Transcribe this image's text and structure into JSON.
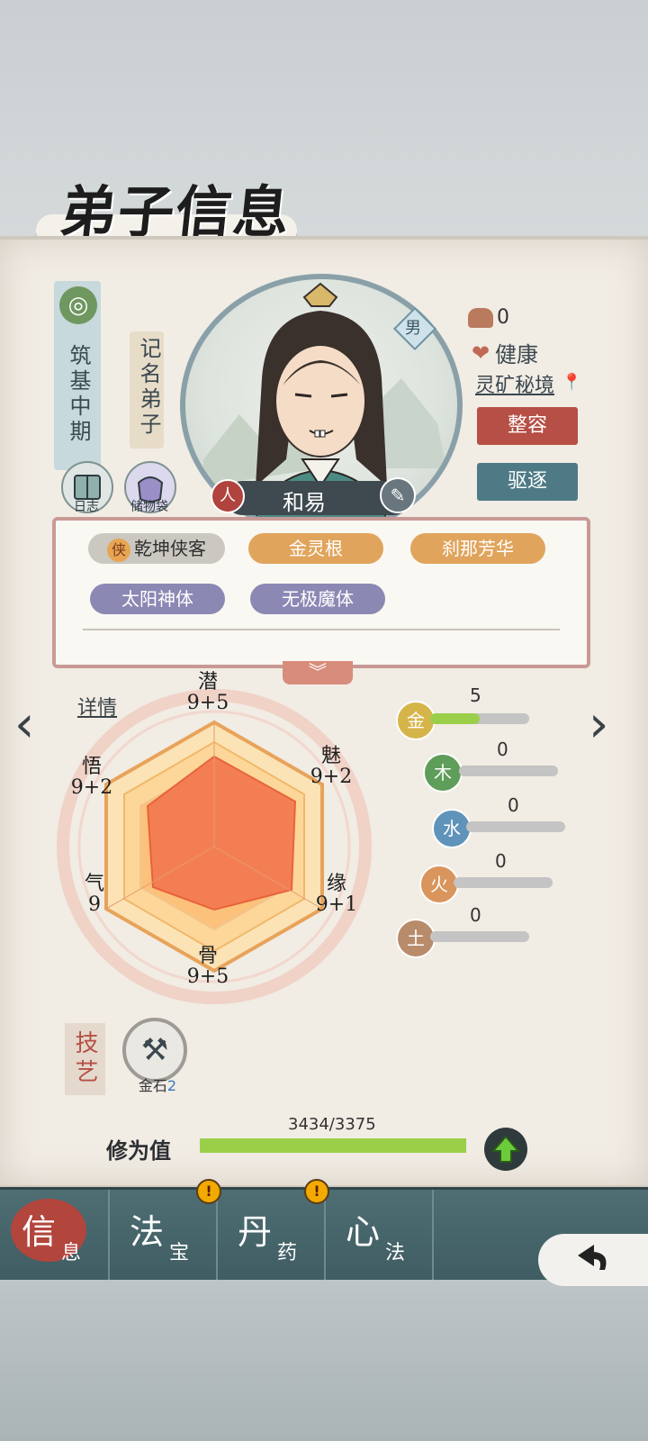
{
  "title": "弟子信息",
  "realm": {
    "text": "筑基中期",
    "icon": "spiral-emblem-icon"
  },
  "rank": "记名弟子",
  "gender": "男",
  "name": "和易",
  "left_buttons": [
    {
      "label": "日志",
      "icon": "book-icon"
    },
    {
      "label": "储物袋",
      "icon": "bag-icon"
    }
  ],
  "status": {
    "resource_count": "0",
    "health": "健康",
    "location": "灵矿秘境"
  },
  "action_buttons": {
    "makeover": "整容",
    "expel": "驱逐"
  },
  "traits": {
    "row1": [
      "乾坤侠客",
      "金灵根",
      "刹那芳华"
    ],
    "row2": [
      "太阳神体",
      "无极魔体"
    ],
    "badge_char": "侠"
  },
  "stats": {
    "details_label": "详情",
    "qian": {
      "name": "潜",
      "value": "9+5"
    },
    "mei": {
      "name": "魅",
      "value": "9+2"
    },
    "yuan": {
      "name": "缘",
      "value": "9+1"
    },
    "gu": {
      "name": "骨",
      "value": "9+5"
    },
    "qi": {
      "name": "气",
      "value": "9"
    },
    "wu": {
      "name": "悟",
      "value": "9+2"
    }
  },
  "elements": [
    {
      "char": "金",
      "value": "5",
      "color": "#d5b44a",
      "fraction": 0.5
    },
    {
      "char": "木",
      "value": "0",
      "color": "#5f9d5a",
      "fraction": 0
    },
    {
      "char": "水",
      "value": "0",
      "color": "#5f93b9",
      "fraction": 0
    },
    {
      "char": "火",
      "value": "0",
      "color": "#d9955c",
      "fraction": 0
    },
    {
      "char": "土",
      "value": "0",
      "color": "#b88b6a",
      "fraction": 0
    }
  ],
  "skills": {
    "label": "技艺",
    "item_name": "金石",
    "item_level": "2"
  },
  "cultivation": {
    "label": "修为值",
    "text": "3434/3375",
    "fraction": 1.0
  },
  "tabs": [
    {
      "big": "信",
      "small": "息",
      "active": true,
      "alert": false
    },
    {
      "big": "法",
      "small": "宝",
      "active": false,
      "alert": true
    },
    {
      "big": "丹",
      "small": "药",
      "active": false,
      "alert": true
    },
    {
      "big": "心",
      "small": "法",
      "active": false,
      "alert": false
    }
  ],
  "colors": {
    "accent_red": "#b64f45",
    "accent_teal": "#4e7a86",
    "radar_fill": "#f47b52",
    "bar_green": "#9bcf4a"
  }
}
